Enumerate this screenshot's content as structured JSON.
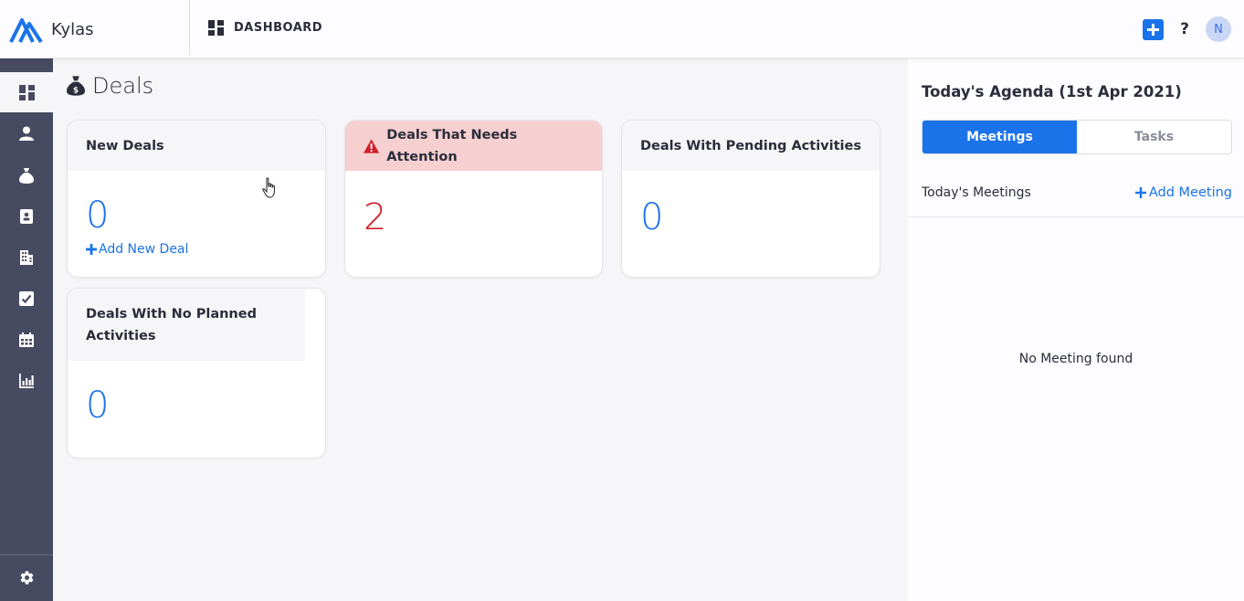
{
  "app": {
    "name": "Kylas",
    "brand_color": "#1a73e8"
  },
  "topbar": {
    "section_label": "DASHBOARD",
    "help_label": "?",
    "avatar_initial": "N"
  },
  "sidebar": {
    "items": [
      {
        "icon": "dashboard-icon",
        "active": true
      },
      {
        "icon": "contacts-icon",
        "active": false
      },
      {
        "icon": "deals-money-bag-icon",
        "active": false
      },
      {
        "icon": "address-book-icon",
        "active": false
      },
      {
        "icon": "building-icon",
        "active": false
      },
      {
        "icon": "tasks-check-icon",
        "active": false
      },
      {
        "icon": "calendar-icon",
        "active": false
      },
      {
        "icon": "reports-chart-icon",
        "active": false
      }
    ],
    "footer_icon": "settings-gear-icon"
  },
  "main": {
    "title": "Deals",
    "cards": [
      {
        "title": "New Deals",
        "count": "0",
        "link": "Add New Deal"
      },
      {
        "title": "Deals That Needs Attention",
        "count": "2",
        "status_color": "#d0202a"
      },
      {
        "title": "Deals With Pending Activities",
        "count": "0"
      },
      {
        "title": "Deals With No Planned Activities",
        "count": "0"
      }
    ]
  },
  "agenda": {
    "title": "Today's Agenda (1st Apr 2021)",
    "tabs": [
      {
        "label": "Meetings",
        "active": true
      },
      {
        "label": "Tasks",
        "active": false
      }
    ],
    "meetings_label": "Today's Meetings",
    "add_meeting_label": "Add Meeting",
    "empty_message": "No Meeting found"
  }
}
